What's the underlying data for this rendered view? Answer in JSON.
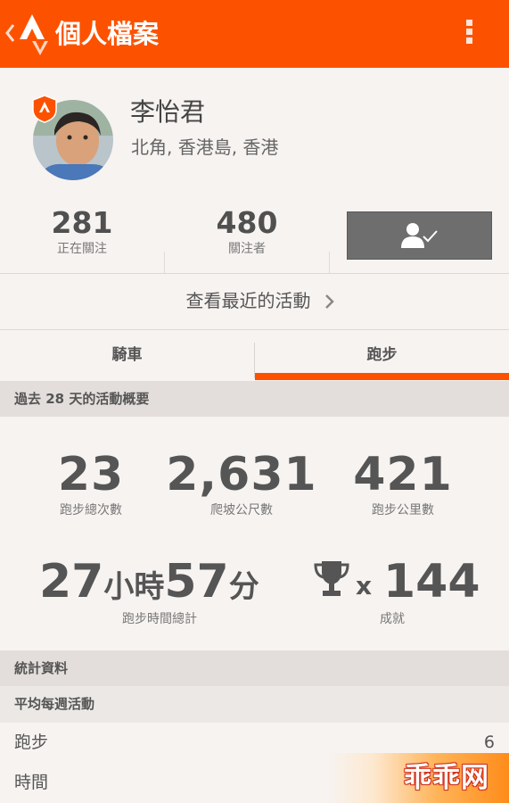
{
  "appbar": {
    "title": "個人檔案"
  },
  "profile": {
    "name": "李怡君",
    "location": "北角, 香港島, 香港",
    "following_count": "281",
    "following_label": "正在關注",
    "followers_count": "480",
    "followers_label": "關注者"
  },
  "recent_activity": {
    "label": "查看最近的活動"
  },
  "tabs": [
    {
      "label": "騎車",
      "selected": false
    },
    {
      "label": "跑步",
      "selected": true
    }
  ],
  "summary": {
    "header": "過去 28 天的活動概要",
    "total_runs": {
      "value": "23",
      "label": "跑步總次數"
    },
    "elevation": {
      "value": "2,631",
      "label": "爬坡公尺數"
    },
    "distance": {
      "value": "421",
      "label": "跑步公里數"
    },
    "time": {
      "hours": "27",
      "hours_unit": "小時",
      "minutes": "57",
      "minutes_unit": "分",
      "label": "跑步時間總計"
    },
    "achievements": {
      "prefix": "x",
      "value": "144",
      "label": "成就"
    }
  },
  "stats": {
    "header": "統計資料",
    "subheader": "平均每週活動",
    "rows": [
      {
        "label": "跑步",
        "value": "6"
      },
      {
        "label": "時間",
        "value": ""
      }
    ]
  },
  "watermark": {
    "text": "乖乖网"
  },
  "colors": {
    "brand": "#fc5200",
    "follow_button": "#6e6e6e"
  },
  "icons": {
    "back": "chevron-left-icon",
    "logo": "strava-logo-icon",
    "menu": "overflow-menu-icon",
    "badge": "premium-shield-icon",
    "follow": "person-check-icon",
    "chevron": "chevron-right-icon",
    "trophy": "trophy-icon"
  }
}
